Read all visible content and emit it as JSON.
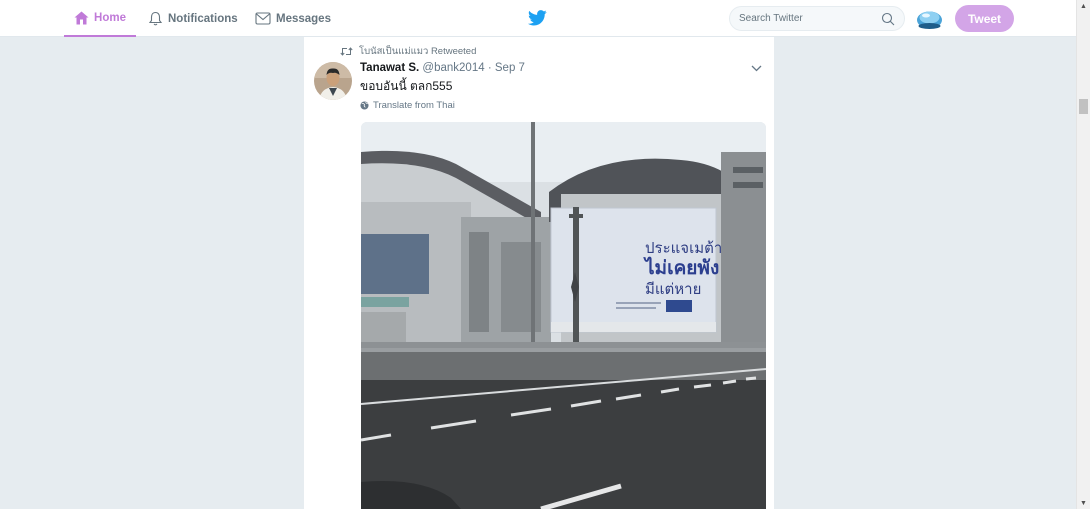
{
  "nav": {
    "home_label": "Home",
    "notifications_label": "Notifications",
    "messages_label": "Messages"
  },
  "search": {
    "placeholder": "Search Twitter"
  },
  "tweet_button_label": "Tweet",
  "colors": {
    "accent": "#c07ad8",
    "tweet_button": "#d3a5e7",
    "background": "#e6ecf0",
    "text_secondary": "#657786"
  },
  "tweet": {
    "retweeted_by": "โบนัสเป็นแม่แมว Retweeted",
    "author_name": "Tanawat S.",
    "author_handle": "@bank2014",
    "separator": "·",
    "date": "Sep 7",
    "text": "ขอบอันนี้ ตลก555",
    "translate_label": "Translate from Thai",
    "billboard": {
      "line1": "ประแจเมต้า",
      "line2": "ไม่เคยพัง",
      "line3": "มีแต่หาย"
    }
  },
  "icons": [
    "home-icon",
    "bell-icon",
    "envelope-icon",
    "twitter-bird-icon",
    "search-icon",
    "retweet-icon",
    "chevron-down-icon",
    "globe-icon"
  ]
}
